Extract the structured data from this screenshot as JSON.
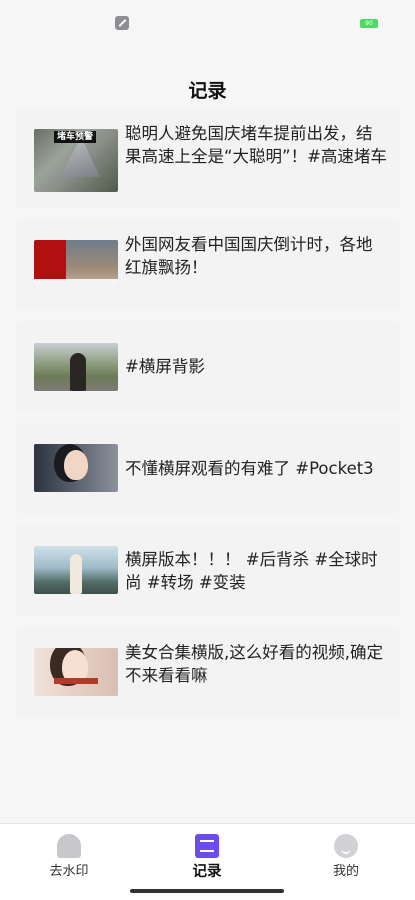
{
  "status_bar": {
    "battery": "90"
  },
  "page": {
    "title": "记录"
  },
  "records": [
    {
      "text": "聪明人避免国庆堵车提前出发，结果高速上全是“大聪明”！#高速堵车",
      "thumb_label": "堵车预警",
      "thumb_icon": "traffic-jam-thumbnail"
    },
    {
      "text": "外国网友看中国国庆倒计时，各地红旗飘扬！",
      "thumb_icon": "red-flag-thumbnail"
    },
    {
      "text": "#横屏背影",
      "thumb_icon": "back-view-thumbnail"
    },
    {
      "text": "不懂横屏观看的有难了 #Pocket3",
      "thumb_icon": "portrait-thumbnail"
    },
    {
      "text": "横屏版本！！！ #后背杀 #全球时尚 #转场 #变装",
      "thumb_icon": "lakeside-thumbnail"
    },
    {
      "text": "美女合集横版,这么好看的视频,确定不来看看嘛",
      "thumb_icon": "girl-portrait-thumbnail"
    }
  ],
  "tabbar": {
    "tabs": [
      {
        "label": "去水印",
        "icon": "house-icon"
      },
      {
        "label": "记录",
        "icon": "book-icon",
        "active": true
      },
      {
        "label": "我的",
        "icon": "smile-face-icon"
      }
    ]
  },
  "colors": {
    "accent": "#6a4cf0",
    "background": "#f6f6f7"
  }
}
